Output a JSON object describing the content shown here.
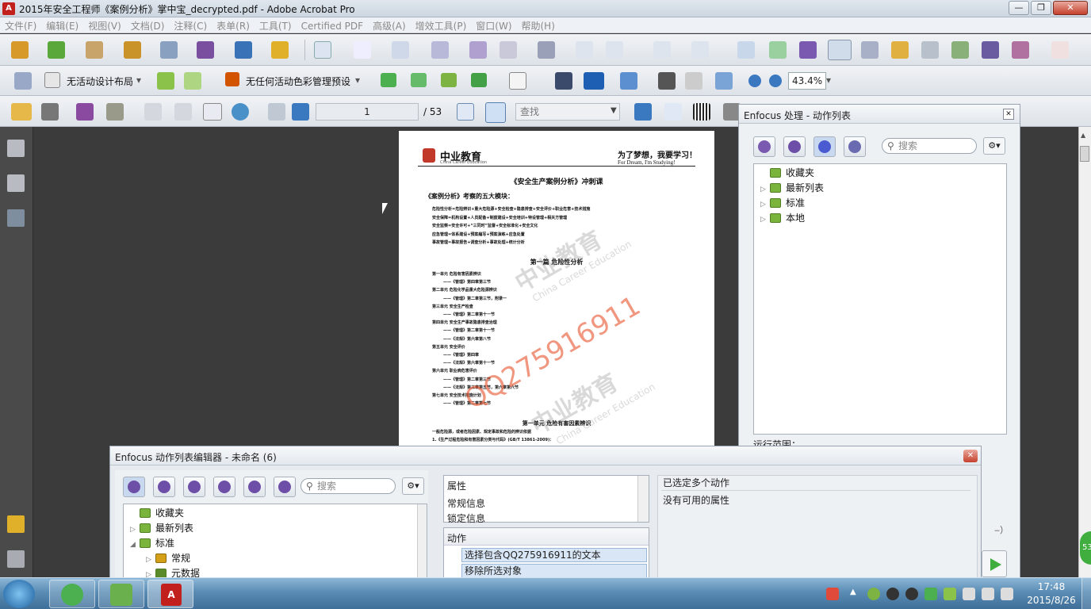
{
  "window": {
    "title": "2015年安全工程师《案例分析》掌中宝_decrypted.pdf - Adobe Acrobat Pro"
  },
  "menu": [
    "文件(F)",
    "编辑(E)",
    "视图(V)",
    "文档(D)",
    "注释(C)",
    "表单(R)",
    "工具(T)",
    "Certified PDF",
    "高级(A)",
    "增效工具(P)",
    "窗口(W)",
    "帮助(H)"
  ],
  "toolbar2": {
    "layout_label": "无活动设计布局",
    "color_label": "无任何活动色彩管理预设",
    "zoom": "43.4%"
  },
  "toolbar3": {
    "page_current": "1",
    "page_total": "/ 53",
    "find_placeholder": "查找"
  },
  "doc": {
    "brand": "中业教育",
    "brand_sub": "China Career Education",
    "slogan": "为了梦想，我要学习！",
    "slogan_en": "For Dream, I'm Studying!",
    "title": "《安全生产案例分析》冲刺课",
    "section": "《案例分析》考察的五大模块：",
    "modules": [
      "危险性分析=危险辨识+重大危险源+安全检查+隐患排查+安全评价+职业危害+技术措施",
      "安全保障=机构设置+人员配备+制度建设+安全培训+特设管理+相关方管理",
      "安全监察=安全许可+“三同时”监督+安全标准化+安全文化",
      "应急管理=体系建设+预案编写+预案演练+应急处置",
      "事故管理=事故报告+调查分析+事故处理+统计分析"
    ],
    "part_title": "第一篇 危险性分析",
    "units": [
      "第一单元 危险有害因素辨识",
      "——《管理》第四章第三节",
      "第二单元 危险化学品重大危险源辨识",
      "——《管理》第二章第三节，附录一",
      "第三单元 安全生产检查",
      "——《管理》第二章第十一节",
      "第四单元 安全生产事故隐患排查治理",
      "——《管理》第二章第十一节",
      "——《法规》第六章第八节",
      "第五单元 安全评价",
      "——《管理》第四章",
      "——《法规》第六章第十一节",
      "第六单元 职业病危害评价",
      "——《管理》第二章第三节",
      "——《法规》第三章第五节，第六章第六节",
      "第七单元 安全技术措施计划",
      "——《管理》第二章第七节"
    ],
    "unit1_title": "第一单元 危险有害因素辨识",
    "unit1_text": "一般危险源，或者危险因素、规定事故和危险的辨识依据",
    "unit1_item": "1.《生产过程危险和有害因素分类与代码》(GB/T 13861-2009)：",
    "watermark_brand": "中业教育",
    "watermark_en": "China Career Education",
    "watermark_qq": "QQ275916911"
  },
  "enfocus_panel": {
    "title": "Enfocus 处理 - 动作列表",
    "search_placeholder": "搜索",
    "tree": [
      "收藏夹",
      "最新列表",
      "标准",
      "本地"
    ],
    "footer_label": "运行范围：",
    "partial_text": "‒）"
  },
  "editor": {
    "title": "Enfocus 动作列表编辑器 - 未命名 (6)",
    "search_placeholder": "搜索",
    "tree": [
      "收藏夹",
      "最新列表",
      "标准",
      "常规",
      "元数据"
    ],
    "props_items": [
      "属性",
      "常规信息",
      "锁定信息"
    ],
    "actions_header": "动作",
    "actions": [
      "选择包含QQ275916911的文本",
      "移除所选对象"
    ],
    "right_title": "已选定多个动作",
    "right_msg": "没有可用的属性"
  },
  "side_badge": "53",
  "taskbar": {
    "time": "17:48",
    "date": "2015/8/26"
  },
  "colors": {
    "accent": "#6d4fa8",
    "folder": "#7ab43c",
    "watermark": "#e8502a"
  }
}
